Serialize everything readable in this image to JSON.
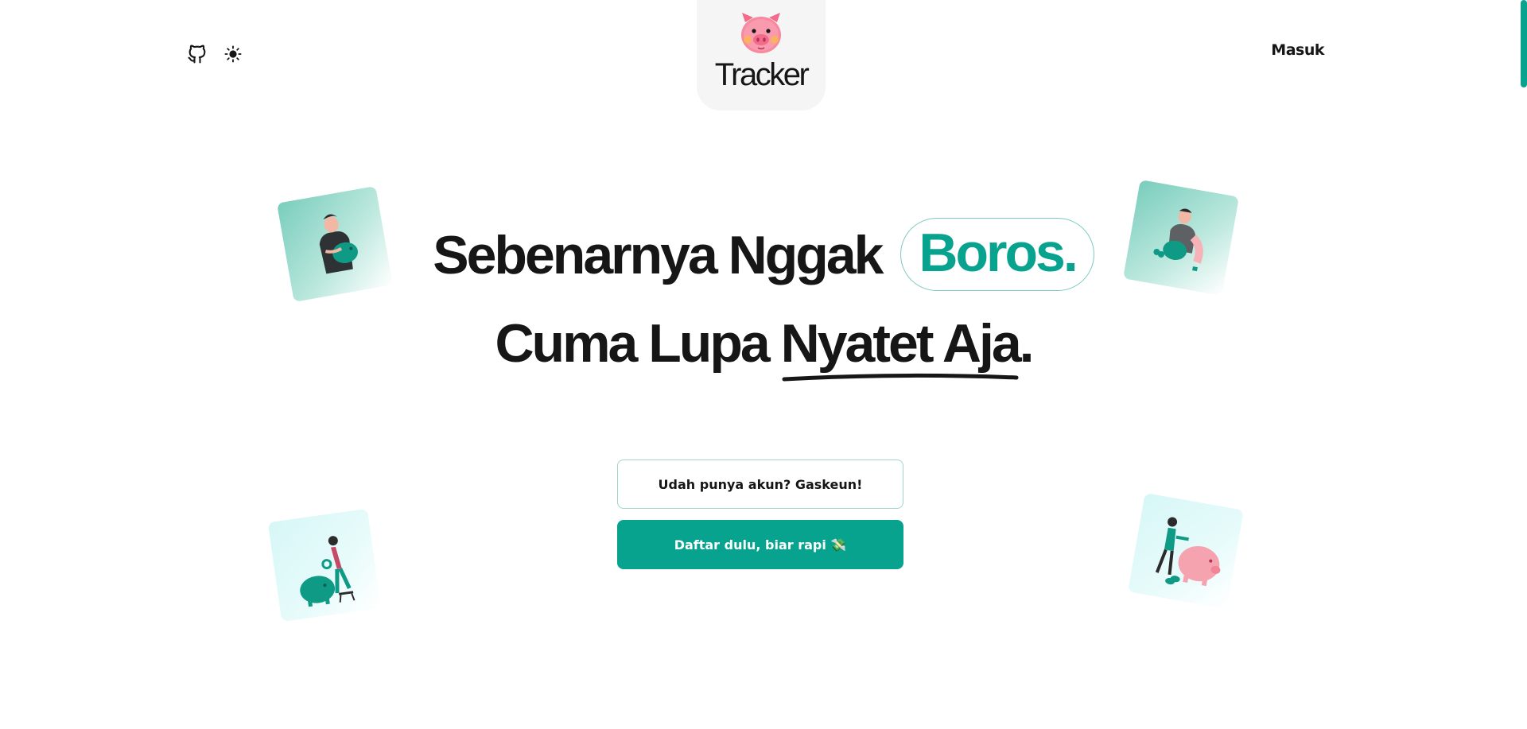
{
  "header": {
    "logo_text": "Tracker",
    "login_label": "Masuk",
    "icons": [
      "github-icon",
      "sun-icon",
      "pig-logo-icon"
    ]
  },
  "hero": {
    "line1_prefix": "Sebenarnya Nggak",
    "line1_highlight": "Boros.",
    "line2_prefix": "Cuma Lupa",
    "line2_underlined": "Nyatet Aja."
  },
  "actions": {
    "login_button": "Udah punya akun? Gaskeun!",
    "register_button": "Daftar dulu, biar rapi 💸"
  },
  "colors": {
    "accent": "#07a38f",
    "text": "#161616",
    "logo_card_bg": "#f4f5f4"
  }
}
